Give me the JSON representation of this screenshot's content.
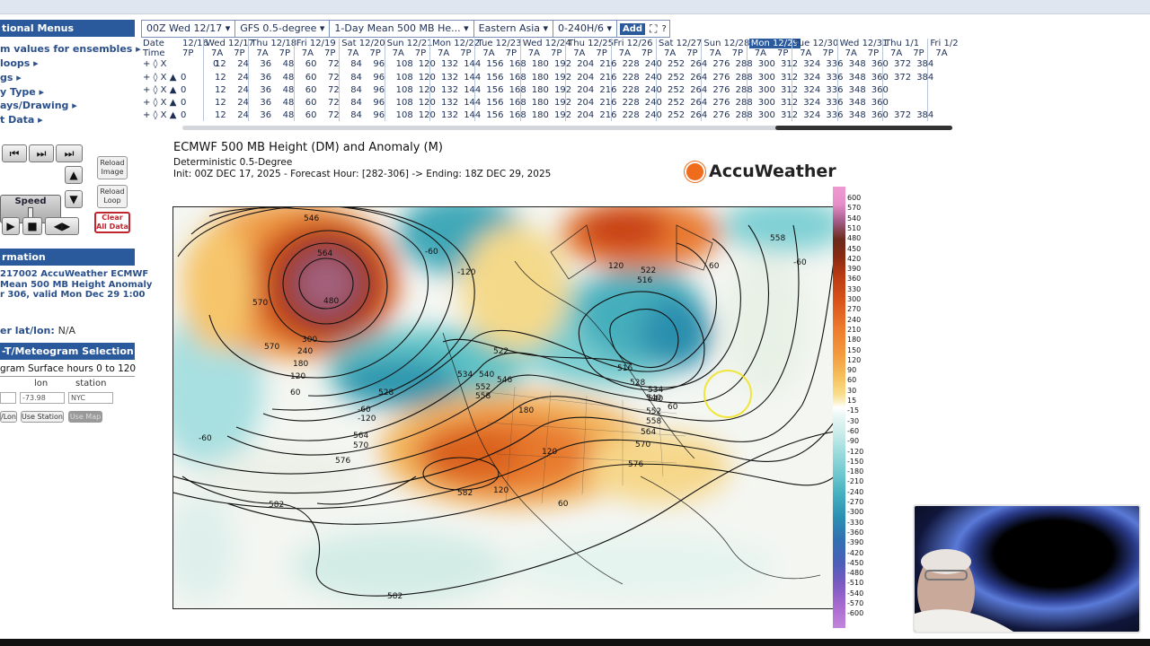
{
  "sidebar": {
    "menus_header": "tional Menus",
    "menu_items": [
      "m values for ensembles ▸",
      "loops ▸",
      "gs ▸",
      "y Type ▸",
      "ays/Drawing ▸",
      "t Data ▸"
    ],
    "reload_image": "Reload Image",
    "reload_loop": "Reload Loop",
    "speed_label": "Speed",
    "clear_all": "Clear All Data",
    "info_header": "rmation",
    "info_lines": [
      "217002 AccuWeather ECMWF",
      "Mean 500 MB Height Anomaly",
      "r 306, valid Mon Dec 29 1:00"
    ],
    "latlon_label": "er lat/lon:",
    "latlon_value": "N/A",
    "meteogram_header": "-T/Meteogram Selection",
    "meteogram_sub": "gram Surface hours 0 to 120",
    "lon_label": "lon",
    "station_label": "station",
    "lon_value": "-73.98",
    "station_value": "NYC",
    "btn_lon": "/Lon",
    "btn_use_station": "Use Station",
    "btn_use_map": "Use Map"
  },
  "toolbar": {
    "items": [
      "00Z Wed 12/17 ▾",
      "GFS 0.5-degree ▾",
      "1-Day Mean 500 MB He... ▾",
      "Eastern Asia ▾",
      "0-240H/6 ▾"
    ],
    "add_label": "Add",
    "fullscreen_icon": "⛶",
    "help_icon": "?"
  },
  "dategrid": {
    "date_label": "Date",
    "time_label": "Time",
    "days": [
      "12/16",
      "Wed 12/17",
      "Thu 12/18",
      "Fri 12/19",
      "Sat 12/20",
      "Sun 12/21",
      "Mon 12/22",
      "Tue 12/23",
      "Wed 12/24",
      "Thu 12/25",
      "Fri 12/26",
      "Sat 12/27",
      "Sun 12/28",
      "Mon 12/29",
      "Tue 12/30",
      "Wed 12/31",
      "Thu 1/1",
      "Fri 1/2"
    ],
    "times": [
      "7P",
      "7A",
      "7P",
      "7A",
      "7P",
      "7A",
      "7P",
      "7A",
      "7P",
      "7A",
      "7P",
      "7A",
      "7P",
      "7A",
      "7P",
      "7A",
      "7P",
      "7A",
      "7P",
      "7A",
      "7P",
      "7A",
      "7P",
      "7A",
      "7P",
      "7A",
      "7P",
      "7A",
      "7P",
      "7A",
      "7P",
      "7A",
      "7P",
      "7A",
      "7P",
      "7A"
    ],
    "row_prefix": "+ ◊ X",
    "row_prefix_b": "+ ◊ X ▲",
    "rows": [
      [
        "0",
        "12",
        "24",
        "36",
        "48",
        "60",
        "72",
        "84",
        "96",
        "108",
        "120",
        "132",
        "144",
        "156",
        "168",
        "180",
        "192",
        "204",
        "216",
        "228",
        "240",
        "252",
        "264",
        "276",
        "288",
        "300",
        "312",
        "324",
        "336",
        "348",
        "360",
        "372",
        "384"
      ],
      [
        "0",
        "12",
        "24",
        "36",
        "48",
        "60",
        "72",
        "84",
        "96",
        "108",
        "120",
        "132",
        "144",
        "156",
        "168",
        "180",
        "192",
        "204",
        "216",
        "228",
        "240",
        "252",
        "264",
        "276",
        "288",
        "300",
        "312",
        "324",
        "336",
        "348",
        "360",
        "372",
        "384"
      ],
      [
        "0",
        "12",
        "24",
        "36",
        "48",
        "60",
        "72",
        "84",
        "96",
        "108",
        "120",
        "132",
        "144",
        "156",
        "168",
        "180",
        "192",
        "204",
        "216",
        "228",
        "240",
        "252",
        "264",
        "276",
        "288",
        "300",
        "312",
        "324",
        "336",
        "348",
        "360"
      ],
      [
        "0",
        "12",
        "24",
        "36",
        "48",
        "60",
        "72",
        "84",
        "96",
        "108",
        "120",
        "132",
        "144",
        "156",
        "168",
        "180",
        "192",
        "204",
        "216",
        "228",
        "240",
        "252",
        "264",
        "276",
        "288",
        "300",
        "312",
        "324",
        "336",
        "348",
        "360"
      ],
      [
        "0",
        "12",
        "24",
        "36",
        "48",
        "60",
        "72",
        "84",
        "96",
        "108",
        "120",
        "132",
        "144",
        "156",
        "168",
        "180",
        "192",
        "204",
        "216",
        "228",
        "240",
        "252",
        "264",
        "276",
        "288",
        "300",
        "312",
        "324",
        "336",
        "348",
        "360",
        "372",
        "384"
      ]
    ],
    "selected_day": "Mon 12/29"
  },
  "map": {
    "title": "ECMWF 500 MB Height (DM) and Anomaly (M)",
    "subtitle": "Deterministic 0.5-Degree",
    "init_line": "Init: 00Z DEC 17, 2025 - Forecast Hour: [282-306] -> Ending: 18Z DEC 29, 2025",
    "brand": "AccuWeather",
    "contour_labels": [
      "546",
      "564",
      "570",
      "570",
      "480",
      "300",
      "240",
      "180",
      "120",
      "60",
      "528",
      "522",
      "516",
      "534",
      "540",
      "552",
      "558",
      "540",
      "546",
      "564",
      "570",
      "576",
      "582",
      "582",
      "582",
      "516",
      "522",
      "528",
      "534",
      "540",
      "552",
      "558",
      "564",
      "570",
      "576",
      "-120",
      "-60",
      "-120",
      "-60",
      "-60",
      "120",
      "60",
      "60",
      "120",
      "558",
      "-60",
      "180",
      "120",
      "60"
    ]
  },
  "colorbar": {
    "labels": [
      "600",
      "570",
      "540",
      "510",
      "480",
      "450",
      "420",
      "390",
      "360",
      "330",
      "300",
      "270",
      "240",
      "210",
      "180",
      "150",
      "120",
      "90",
      "60",
      "30",
      "15",
      "-15",
      "-30",
      "-60",
      "-90",
      "-120",
      "-150",
      "-180",
      "-210",
      "-240",
      "-270",
      "-300",
      "-330",
      "-360",
      "-390",
      "-420",
      "-450",
      "-480",
      "-510",
      "-540",
      "-570",
      "-600"
    ]
  },
  "colors": {
    "accent": "#2a5a9c",
    "clear": "#c0262d",
    "brand_sun": "#ef6c1d"
  }
}
